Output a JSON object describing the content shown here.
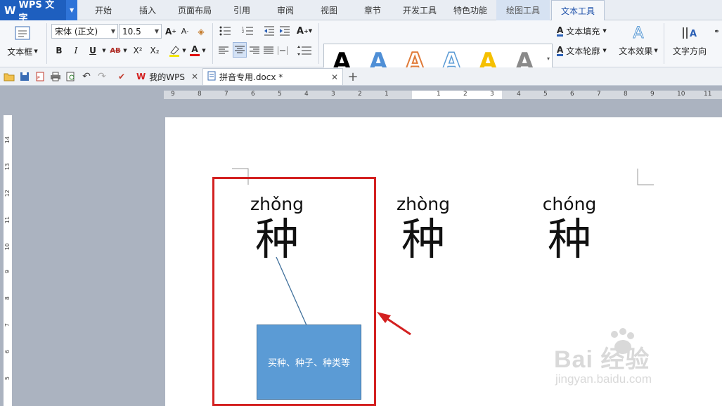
{
  "app": {
    "logo": "WPS 文字",
    "tabs": [
      "开始",
      "插入",
      "页面布局",
      "引用",
      "审阅",
      "视图",
      "章节",
      "开发工具",
      "特色功能",
      "绘图工具",
      "文本工具"
    ],
    "active_tab": "文本工具"
  },
  "ribbon": {
    "textbox_label": "文本框",
    "font_name": "宋体 (正文)",
    "font_size": "10.5",
    "bold": "B",
    "italic": "I",
    "underline": "U",
    "strike": "AB",
    "superscript": "X²",
    "subscript": "X₂",
    "font_color_glyph": "A",
    "art_letter": "A",
    "text_fill": "文本填充",
    "text_outline": "文本轮廓",
    "text_effect": "文本效果",
    "text_direction": "文字方向"
  },
  "doc_tabs": [
    {
      "label": "我的WPS"
    },
    {
      "label": "拼音专用.docx *"
    }
  ],
  "ruler": {
    "h_left": [
      "9",
      "8",
      "7",
      "6",
      "5",
      "4",
      "3",
      "2",
      "1"
    ],
    "h_right": [
      "1",
      "2",
      "3",
      "4",
      "5",
      "6",
      "7",
      "8",
      "9",
      "10",
      "11"
    ],
    "v": [
      "14",
      "13",
      "12",
      "11",
      "10",
      "9",
      "8",
      "7",
      "6",
      "5"
    ]
  },
  "content": {
    "entries": [
      {
        "pinyin": "zhǒng",
        "hanzi": "种"
      },
      {
        "pinyin": "zhòng",
        "hanzi": "种"
      },
      {
        "pinyin": "chóng",
        "hanzi": "种"
      }
    ],
    "callout_text": "买种、种子、种类等"
  },
  "watermark": {
    "brand": "Bai  经验",
    "url": "jingyan.baidu.com"
  },
  "colors": {
    "accent_blue": "#1e5fbf",
    "callout_fill": "#5b9bd5",
    "highlight_red": "#d32020"
  }
}
